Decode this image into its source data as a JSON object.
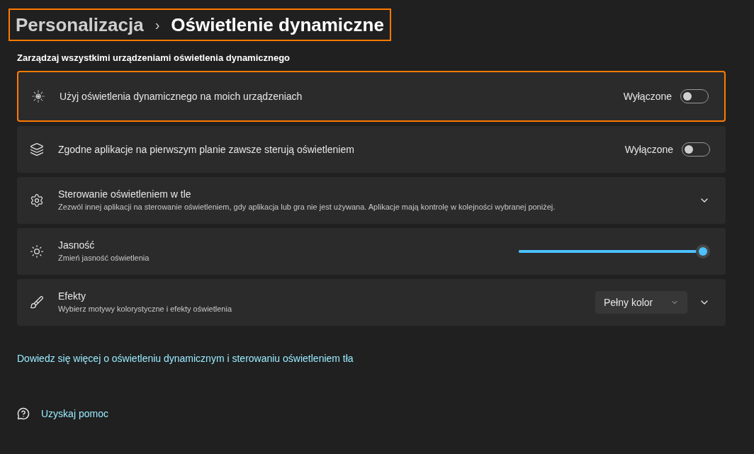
{
  "breadcrumb": {
    "parent": "Personalizacja",
    "separator": "›",
    "current": "Oświetlenie dynamiczne",
    "highlighted": true
  },
  "section_title": "Zarządzaj wszystkimi urządzeniami oświetlenia dynamicznego",
  "rows": [
    {
      "kind": "toggle",
      "title": "Użyj oświetlenia dynamicznego na moich urządzeniach",
      "state_label": "Wyłączone",
      "on": false,
      "highlighted": true
    },
    {
      "kind": "toggle",
      "title": "Zgodne aplikacje na pierwszym planie zawsze sterują oświetleniem",
      "state_label": "Wyłączone",
      "on": false,
      "highlighted": false
    },
    {
      "kind": "expander",
      "title": "Sterowanie oświetleniem w tle",
      "description": "Zezwól innej aplikacji na sterowanie oświetleniem, gdy aplikacja lub gra nie jest używana. Aplikacje mają kontrolę w kolejności wybranej poniżej.",
      "expanded": false,
      "highlighted": false
    },
    {
      "kind": "slider",
      "title": "Jasność",
      "description": "Zmień jasność oświetlenia",
      "level": 1,
      "highlighted": false
    },
    {
      "kind": "dropdown",
      "title": "Efekty",
      "description": "Wybierz motywy kolorystyczne i efekty oświetlenia",
      "value": "Pełny kolor",
      "expanded": false,
      "highlighted": false
    }
  ],
  "learn_more_link": "Dowiedz się więcej o oświetleniu dynamicznym i sterowaniu oświetleniem tła",
  "help_link": "Uzyskaj pomoc"
}
